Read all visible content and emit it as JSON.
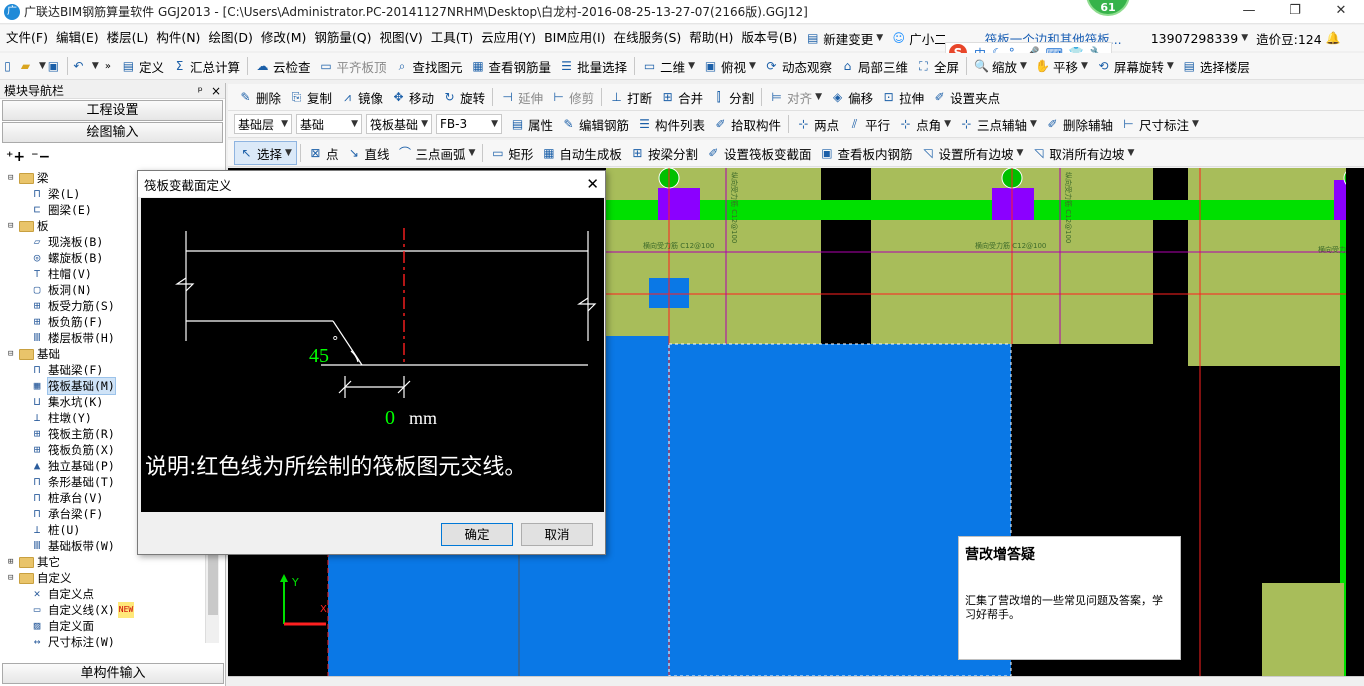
{
  "window": {
    "title": "广联达BIM钢筋算量软件 GGJ2013 - [C:\\Users\\Administrator.PC-20141127NRHM\\Desktop\\白龙村-2016-08-25-13-27-07(2166版).GGJ12]",
    "app_icon": "广",
    "notif_count": "61",
    "min": "—",
    "max": "❐",
    "close": "✕"
  },
  "menu": [
    "文件(F)",
    "编辑(E)",
    "楼层(L)",
    "构件(N)",
    "绘图(D)",
    "修改(M)",
    "钢筋量(Q)",
    "视图(V)",
    "工具(T)",
    "云应用(Y)",
    "BIM应用(I)",
    "在线服务(S)",
    "帮助(H)",
    "版本号(B)"
  ],
  "menu_right": {
    "new_change": "新建变更",
    "assistant": "广小二",
    "news": "筏板一个边和其他筏板...",
    "phone": "13907298339",
    "beans": "造价豆:124"
  },
  "toolbar1": [
    "定义",
    "汇总计算",
    "云检查",
    "平齐板顶",
    "查找图元",
    "查看钢筋量",
    "批量选择",
    "二维",
    "俯视",
    "动态观察",
    "局部三维",
    "全屏",
    "缩放",
    "平移",
    "屏幕旋转",
    "选择楼层"
  ],
  "toolbar2": [
    "删除",
    "复制",
    "镜像",
    "移动",
    "旋转",
    "延伸",
    "修剪",
    "打断",
    "合并",
    "分割",
    "对齐",
    "偏移",
    "拉伸",
    "设置夹点"
  ],
  "toolbar3": {
    "floor": "基础层",
    "category": "基础",
    "type": "筏板基础",
    "item": "FB-3",
    "buttons": [
      "属性",
      "编辑钢筋",
      "构件列表",
      "拾取构件",
      "两点",
      "平行",
      "点角",
      "三点辅轴",
      "删除辅轴",
      "尺寸标注"
    ]
  },
  "toolbar4": [
    "选择",
    "点",
    "直线",
    "三点画弧",
    "矩形",
    "自动生成板",
    "按梁分割",
    "设置筏板变截面",
    "查看板内钢筋",
    "设置所有边坡",
    "取消所有边坡"
  ],
  "ime": {
    "logo": "S",
    "items": [
      "中",
      "☾",
      "°,",
      "🎤",
      "⌨",
      "👕",
      "🔧"
    ]
  },
  "nav": {
    "title": "模块导航栏",
    "pin": "ᵖ",
    "close": "×",
    "btn_project": "工程设置",
    "btn_draw": "绘图输入",
    "btn_single": "单构件输入"
  },
  "tree": [
    {
      "t": "f",
      "label": "梁",
      "exp": "⊟",
      "lvl": 1
    },
    {
      "t": "l",
      "label": "梁(L)",
      "icon": "⊓",
      "lvl": 2
    },
    {
      "t": "l",
      "label": "圈梁(E)",
      "icon": "⊏",
      "lvl": 2
    },
    {
      "t": "f",
      "label": "板",
      "exp": "⊟",
      "lvl": 1
    },
    {
      "t": "l",
      "label": "现浇板(B)",
      "icon": "▱",
      "lvl": 2
    },
    {
      "t": "l",
      "label": "螺旋板(B)",
      "icon": "◎",
      "lvl": 2
    },
    {
      "t": "l",
      "label": "柱帽(V)",
      "icon": "⊤",
      "lvl": 2
    },
    {
      "t": "l",
      "label": "板洞(N)",
      "icon": "▢",
      "lvl": 2
    },
    {
      "t": "l",
      "label": "板受力筋(S)",
      "icon": "⊞",
      "lvl": 2
    },
    {
      "t": "l",
      "label": "板负筋(F)",
      "icon": "⊞",
      "lvl": 2
    },
    {
      "t": "l",
      "label": "楼层板带(H)",
      "icon": "Ⅲ",
      "lvl": 2
    },
    {
      "t": "f",
      "label": "基础",
      "exp": "⊟",
      "lvl": 1
    },
    {
      "t": "l",
      "label": "基础梁(F)",
      "icon": "⊓",
      "lvl": 2
    },
    {
      "t": "l",
      "label": "筏板基础(M)",
      "icon": "▦",
      "lvl": 2,
      "sel": true
    },
    {
      "t": "l",
      "label": "集水坑(K)",
      "icon": "⊔",
      "lvl": 2
    },
    {
      "t": "l",
      "label": "柱墩(Y)",
      "icon": "⊥",
      "lvl": 2
    },
    {
      "t": "l",
      "label": "筏板主筋(R)",
      "icon": "⊞",
      "lvl": 2
    },
    {
      "t": "l",
      "label": "筏板负筋(X)",
      "icon": "⊞",
      "lvl": 2
    },
    {
      "t": "l",
      "label": "独立基础(P)",
      "icon": "▲",
      "lvl": 2
    },
    {
      "t": "l",
      "label": "条形基础(T)",
      "icon": "⊓",
      "lvl": 2
    },
    {
      "t": "l",
      "label": "桩承台(V)",
      "icon": "⊓",
      "lvl": 2
    },
    {
      "t": "l",
      "label": "承台梁(F)",
      "icon": "⊓",
      "lvl": 2
    },
    {
      "t": "l",
      "label": "桩(U)",
      "icon": "⊥",
      "lvl": 2
    },
    {
      "t": "l",
      "label": "基础板带(W)",
      "icon": "Ⅲ",
      "lvl": 2
    },
    {
      "t": "f",
      "label": "其它",
      "exp": "⊞",
      "lvl": 1
    },
    {
      "t": "f",
      "label": "自定义",
      "exp": "⊟",
      "lvl": 1
    },
    {
      "t": "l",
      "label": "自定义点",
      "icon": "✕",
      "lvl": 2
    },
    {
      "t": "l",
      "label": "自定义线(X)",
      "icon": "▭",
      "lvl": 2,
      "new": "NEW"
    },
    {
      "t": "l",
      "label": "自定义面",
      "icon": "▨",
      "lvl": 2
    },
    {
      "t": "l",
      "label": "尺寸标注(W)",
      "icon": "↔",
      "lvl": 2
    }
  ],
  "canvas": {
    "rebar_labels": [
      "横向受力筋 C12@100",
      "横向受力筋 C12@100",
      "横向受力筋",
      "纵向受力筋 C12@100",
      "纵向受力筋 C12@100"
    ],
    "axis_y": "Y",
    "axis_x": "X"
  },
  "dialog": {
    "title": "筏板变截面定义",
    "angle": "45",
    "deg": "°",
    "offset": "0",
    "unit": "mm",
    "note": "说明:红色线为所绘制的筏板图元交线。",
    "ok": "确定",
    "cancel": "取消"
  },
  "popup": {
    "title": "营改增答疑",
    "body": "汇集了营改增的一些常见问题及答案，学习好帮手。"
  },
  "colors": {
    "accent": "#0078d7",
    "green": "#00e000",
    "olive": "#a8bd5a",
    "blue": "#0a78e6",
    "purple": "#8b00ff",
    "red": "#ff2020"
  }
}
